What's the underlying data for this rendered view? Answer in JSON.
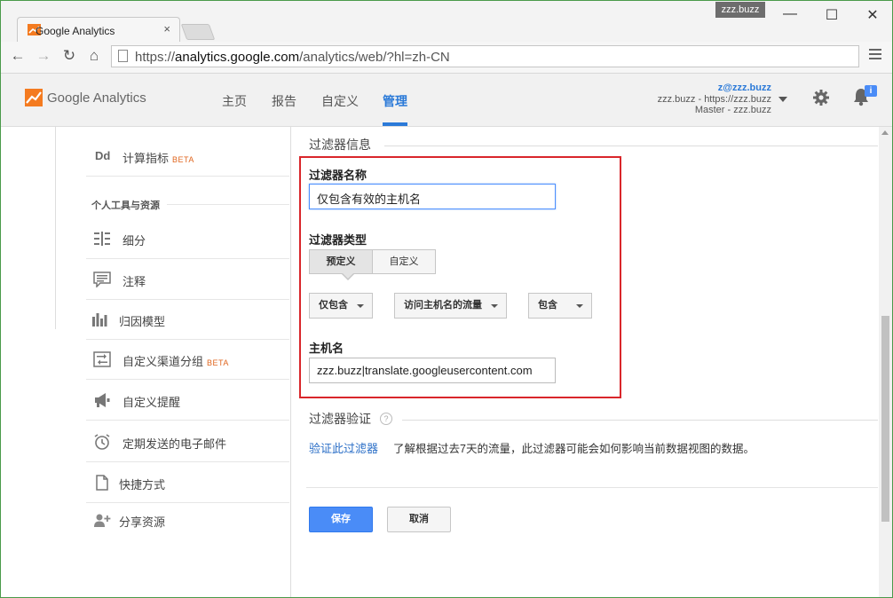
{
  "browser": {
    "tab_title": "Google Analytics",
    "tab_close": "×",
    "user_badge": "zzz.buzz",
    "url_prefix": "https://",
    "url_host": "analytics.google.com",
    "url_path": "/analytics/web/?hl=zh-CN",
    "window_minimize": "—",
    "window_maximize": "☐",
    "window_close": "✕",
    "back": "←",
    "forward": "→",
    "reload": "↻",
    "home": "⌂"
  },
  "header": {
    "brand": "Google Analytics",
    "nav": [
      "主页",
      "报告",
      "自定义",
      "管理"
    ],
    "active_nav": "管理",
    "account_email": "z@zzz.buzz",
    "account_property": "zzz.buzz - https://zzz.buzz",
    "account_view": "Master - zzz.buzz",
    "notification_badge": "i"
  },
  "sidebar": {
    "top_item": {
      "icon": "Dd",
      "label": "计算指标",
      "beta": "BETA"
    },
    "section_title": "个人工具与资源",
    "items": [
      {
        "icon": "segments-icon",
        "label": "细分",
        "beta": ""
      },
      {
        "icon": "annotations-icon",
        "label": "注释",
        "beta": ""
      },
      {
        "icon": "attribution-icon",
        "label": "归因模型",
        "beta": ""
      },
      {
        "icon": "channel-grouping-icon",
        "label": "自定义渠道分组",
        "beta": "BETA"
      },
      {
        "icon": "alerts-icon",
        "label": "自定义提醒",
        "beta": ""
      },
      {
        "icon": "scheduled-email-icon",
        "label": "定期发送的电子邮件",
        "beta": ""
      },
      {
        "icon": "shortcuts-icon",
        "label": "快捷方式",
        "beta": ""
      },
      {
        "icon": "share-assets-icon",
        "label": "分享资源",
        "beta": ""
      }
    ]
  },
  "main": {
    "section_heading": "过滤器信息",
    "filter_name_label": "过滤器名称",
    "filter_name_value": "仅包含有效的主机名",
    "filter_type_label": "过滤器类型",
    "type_tabs": [
      "预定义",
      "自定义"
    ],
    "selected_type": "预定义",
    "dropdowns": [
      "仅包含",
      "访问主机名的流量",
      "包含"
    ],
    "hostname_label": "主机名",
    "hostname_value": "zzz.buzz|translate.googleusercontent.com",
    "verify_heading": "过滤器验证",
    "verify_help": "?",
    "verify_link": "验证此过滤器",
    "verify_desc": "了解根据过去7天的流量，此过滤器可能会如何影响当前数据视图的数据。",
    "save_label": "保存",
    "cancel_label": "取消"
  },
  "colors": {
    "accent": "#4a8cf7",
    "link": "#2b6fc7",
    "highlight_border": "#d9262b",
    "beta": "#e0661f",
    "logo": "#f47b20"
  }
}
